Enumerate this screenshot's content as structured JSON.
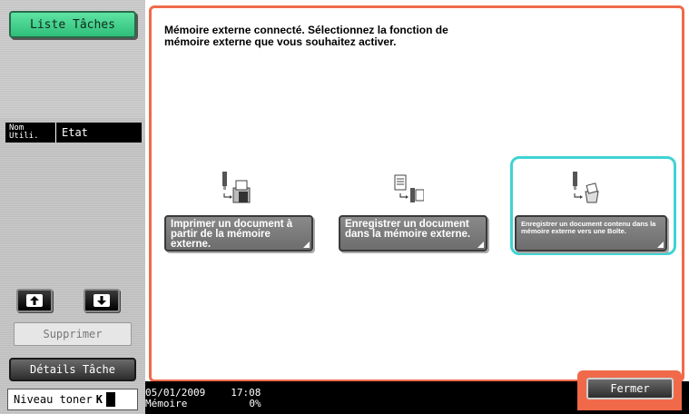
{
  "sidebar": {
    "job_list_label": "Liste Tâches",
    "col_user": "Nom\nUtili.",
    "col_status": "Etat",
    "up_icon": "arrow-up",
    "down_icon": "arrow-down",
    "delete_label": "Supprimer",
    "details_label": "Détails Tâche",
    "toner_label": "Niveau toner",
    "toner_letter": "K"
  },
  "dialog": {
    "message": "Mémoire externe connecté.  Sélectionnez la fonction de mémoire externe que vous souhaitez activer.",
    "functions": [
      {
        "label": "Imprimer un document à partir de la mémoire externe.",
        "icon": "usb-to-printer-icon"
      },
      {
        "label": "Enregistrer un document dans la mémoire externe.",
        "icon": "document-to-usb-icon"
      },
      {
        "label": "Enregistrer un document contenu dans la mémoire externe vers une Boîte.",
        "icon": "usb-to-box-icon"
      }
    ],
    "selected_index": 2
  },
  "status": {
    "date": "05/01/2009",
    "time": "17:08",
    "memory_label": "Mémoire",
    "memory_value": "0%",
    "close_label": "Fermer"
  },
  "colors": {
    "accent": "#f06a4a",
    "focus": "#3fd3d3",
    "job_list_button": "#2fbf7a"
  }
}
